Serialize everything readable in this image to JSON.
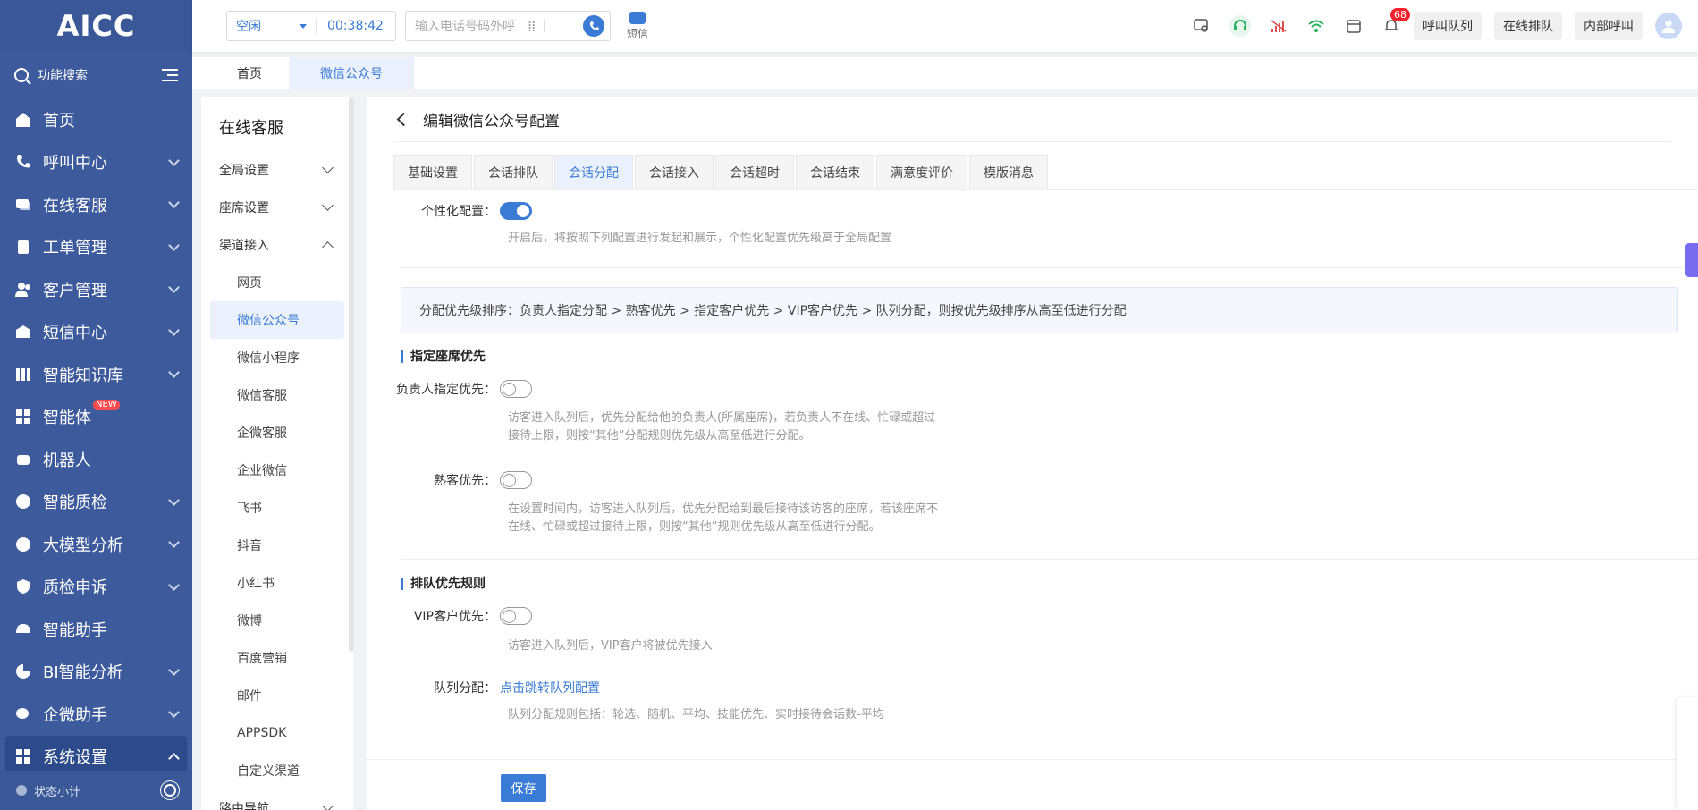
{
  "brand": "AICC",
  "sidebar": {
    "search_label": "功能搜索",
    "items": [
      {
        "label": "首页"
      },
      {
        "label": "呼叫中心"
      },
      {
        "label": "在线客服"
      },
      {
        "label": "工单管理"
      },
      {
        "label": "客户管理"
      },
      {
        "label": "短信中心"
      },
      {
        "label": "智能知识库"
      },
      {
        "label": "智能体",
        "badge": "NEW"
      },
      {
        "label": "机器人"
      },
      {
        "label": "智能质检"
      },
      {
        "label": "大模型分析"
      },
      {
        "label": "质检申诉"
      },
      {
        "label": "智能助手"
      },
      {
        "label": "BI智能分析"
      },
      {
        "label": "企微助手"
      },
      {
        "label": "系统设置"
      }
    ],
    "status_label": "状态小计"
  },
  "topbar": {
    "status": "空闲",
    "timer": "00:38:42",
    "phone_placeholder": "输入电话号码外呼",
    "sms_label": "短信",
    "bell_count": "68",
    "buttons": [
      "呼叫队列",
      "在线排队",
      "内部呼叫"
    ]
  },
  "page_tabs": [
    "首页",
    "微信公众号"
  ],
  "sub_sidebar": {
    "title": "在线客服",
    "groups": [
      "全局设置",
      "座席设置",
      "渠道接入"
    ],
    "channels": [
      "网页",
      "微信公众号",
      "微信小程序",
      "微信客服",
      "企微客服",
      "企业微信",
      "飞书",
      "抖音",
      "小红书",
      "微博",
      "百度营销",
      "邮件",
      "APPSDK",
      "自定义渠道"
    ],
    "last_group": "路由导航"
  },
  "main": {
    "title": "编辑微信公众号配置",
    "tabs": [
      "基础设置",
      "会话排队",
      "会话分配",
      "会话接入",
      "会话超时",
      "会话结束",
      "满意度评价",
      "模版消息"
    ],
    "personal_label": "个性化配置：",
    "personal_hint": "开启后，将按照下列配置进行发起和展示，个性化配置优先级高于全局配置",
    "info": "分配优先级排序：负责人指定分配 > 熟客优先 > 指定客户优先 > VIP客户优先 > 队列分配，则按优先级排序从高至低进行分配",
    "section1_title": "指定座席优先",
    "owner_label": "负责人指定优先：",
    "owner_hint_1": "访客进入队列后，优先分配给他的负责人(所属座席)，若负责人不在线、忙碌或超过",
    "owner_hint_2": "接待上限，则按“其他”分配规则优先级从高至低进行分配。",
    "regular_label": "熟客优先：",
    "regular_hint_1": "在设置时间内，访客进入队列后，优先分配给到最后接待该访客的座席，若该座席不",
    "regular_hint_2": "在线、忙碌或超过接待上限，则按“其他”规则优先级从高至低进行分配。",
    "section2_title": "排队优先规则",
    "vip_label": "VIP客户优先：",
    "vip_hint": "访客进入队列后，VIP客户将被优先接入",
    "queue_label": "队列分配：",
    "queue_link": "点击跳转队列配置",
    "queue_hint": "队列分配规则包括：轮选、随机、平均、技能优先、实时接待会话数-平均",
    "save": "保存"
  },
  "colors": {
    "sidebar": "#3d5a9c",
    "accent": "#3a7bd5"
  }
}
